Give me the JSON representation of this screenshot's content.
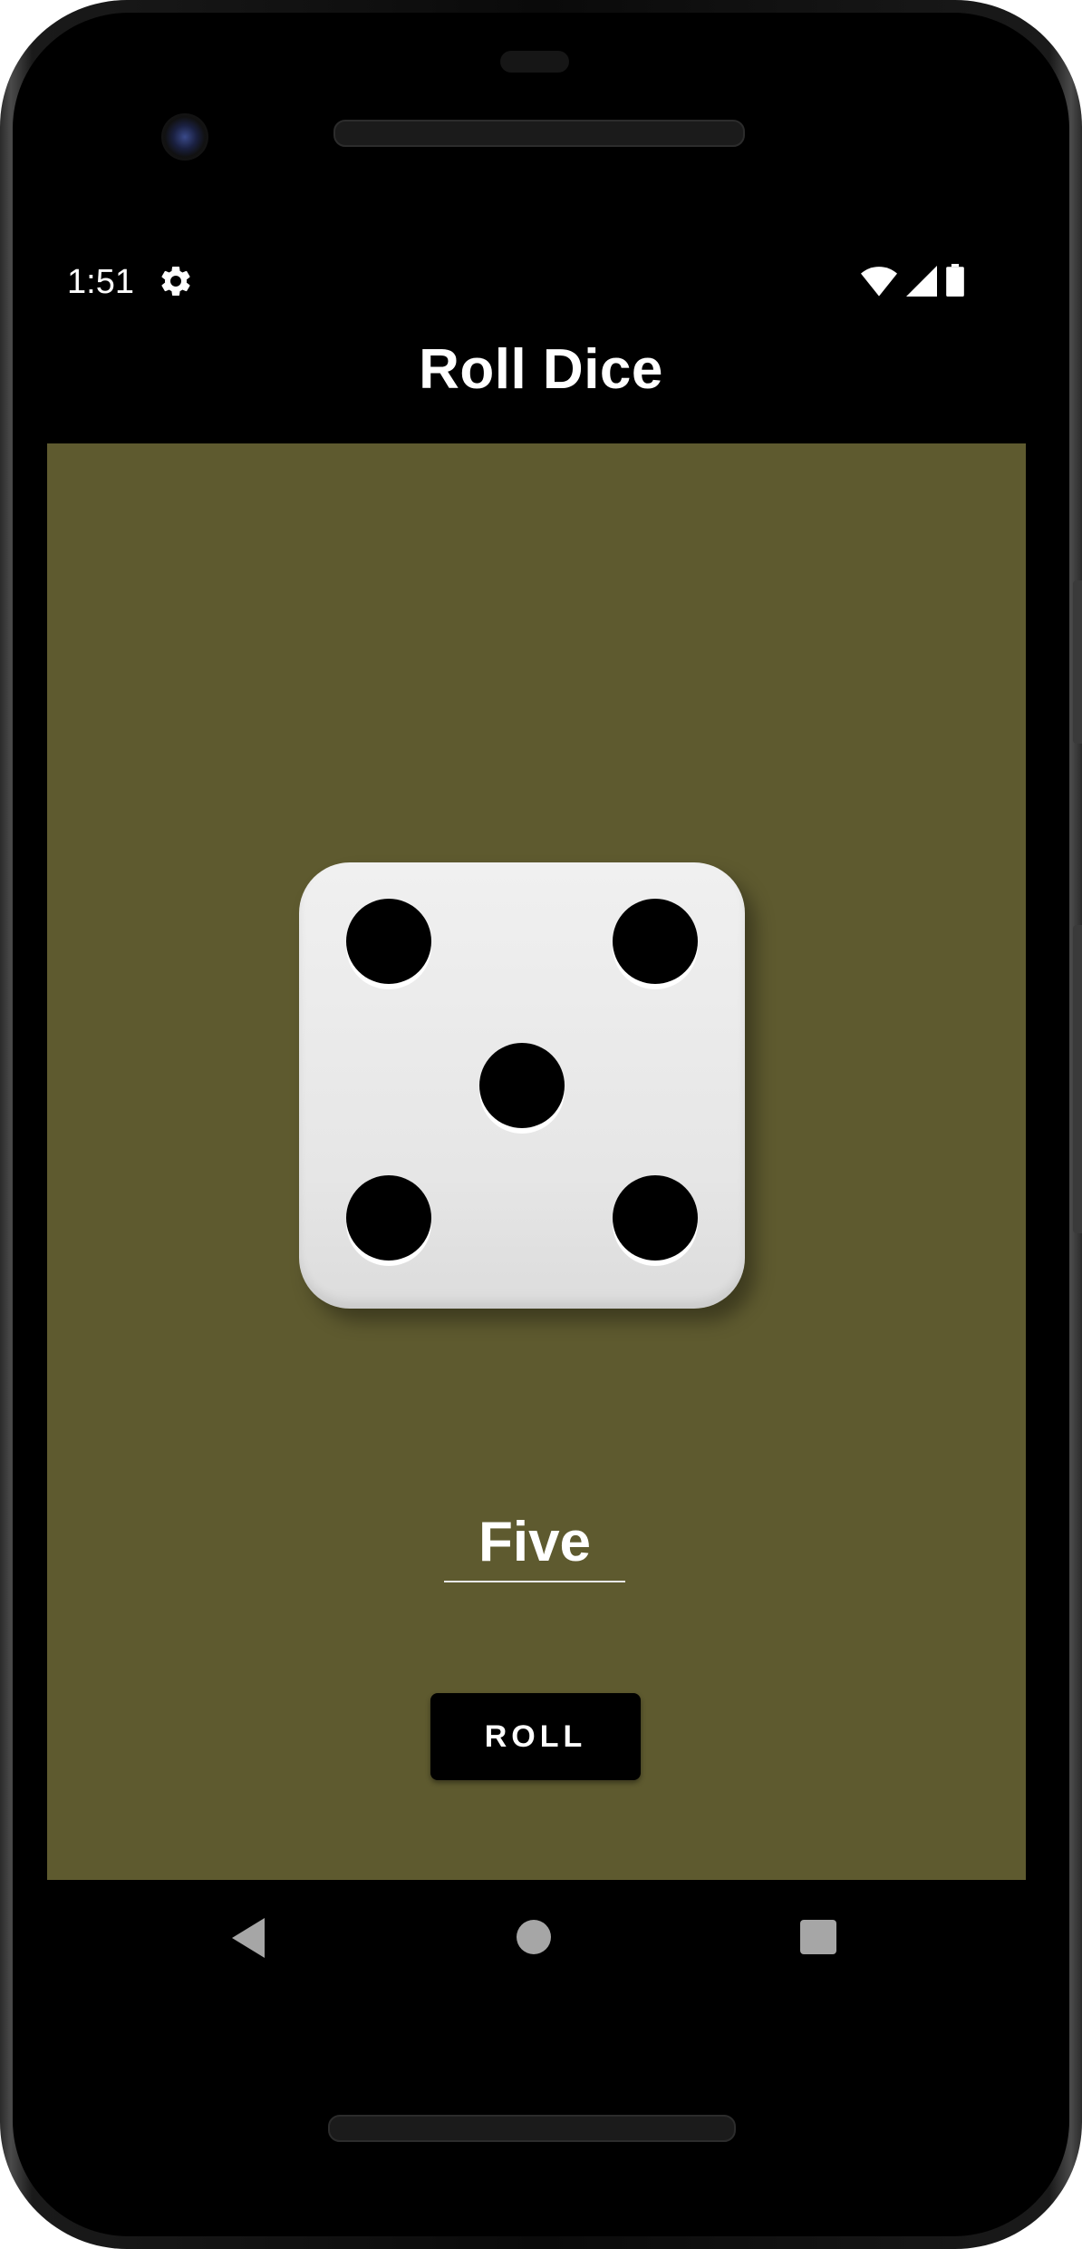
{
  "status_bar": {
    "time": "1:51",
    "icons": [
      "gear-icon",
      "wifi-icon",
      "cellular-signal-icon",
      "battery-icon"
    ]
  },
  "app_bar": {
    "title": "Roll Dice"
  },
  "main": {
    "background_color": "#5e5a2f",
    "dice": {
      "face_value": 5
    },
    "result_text": "Five",
    "roll_button_label": "ROLL"
  },
  "nav_bar": {
    "icons": [
      "back-icon",
      "home-icon",
      "recents-icon"
    ]
  },
  "colors": {
    "accent": "#000000",
    "content_background": "#5e5a2f",
    "text_on_dark": "#ffffff",
    "nav_icon": "#a6a6a6"
  }
}
